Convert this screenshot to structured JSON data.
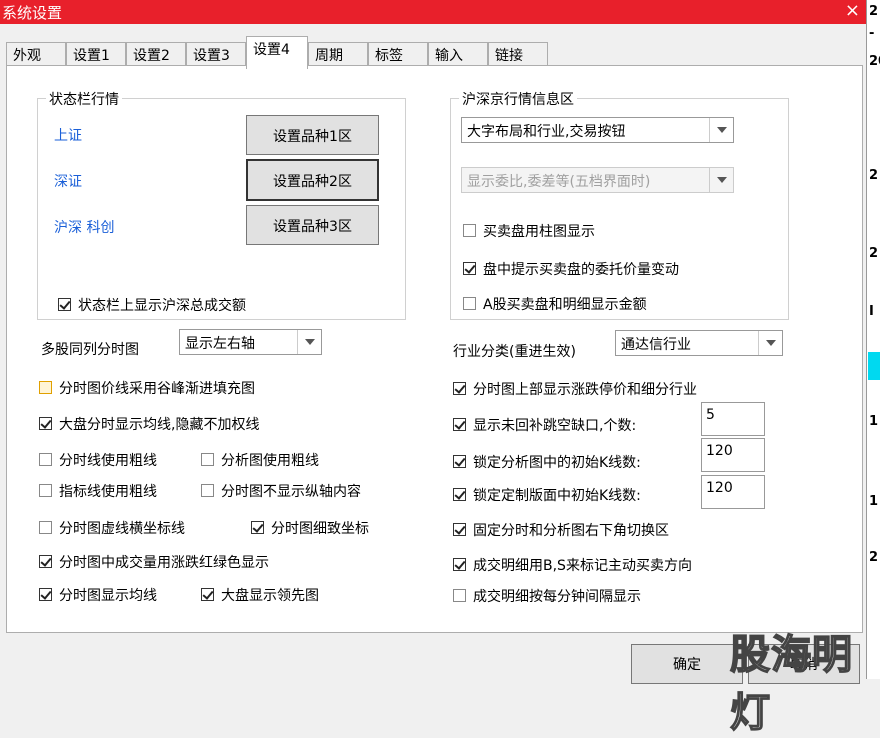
{
  "window": {
    "title": "系统设置",
    "close": "×"
  },
  "tabs": [
    "外观",
    "设置1",
    "设置2",
    "设置3",
    "设置4",
    "周期",
    "标签",
    "输入",
    "链接"
  ],
  "status_group": {
    "title": "状态栏行情",
    "rows": [
      {
        "label": "上证",
        "button": "设置品种1区"
      },
      {
        "label": "深证",
        "button": "设置品种2区"
      },
      {
        "label": "沪深 科创",
        "button": "设置品种3区"
      }
    ],
    "checkbox": {
      "label": "状态栏上显示沪深总成交额",
      "checked": true
    }
  },
  "info_group": {
    "title": "沪深京行情信息区",
    "layout_select": "大字布局和行业,交易按钮",
    "disabled_select": "显示委比,委差等(五档界面时)",
    "checks": [
      {
        "label": "买卖盘用柱图显示",
        "checked": false
      },
      {
        "label": "盘中提示买卖盘的委托价量变动",
        "checked": true
      },
      {
        "label": "A股买卖盘和明细显示金额",
        "checked": false
      }
    ]
  },
  "multi": {
    "label": "多股同列分时图",
    "value": "显示左右轴"
  },
  "industry": {
    "label": "行业分类(重进生效)",
    "value": "通达信行业"
  },
  "left_checks": {
    "gradient": {
      "label": "分时图价线采用谷峰渐进填充图",
      "checked": false
    },
    "avg": {
      "label": "大盘分时显示均线,隐藏不加权线",
      "checked": true
    },
    "thick1": {
      "label": "分时线使用粗线",
      "checked": false
    },
    "thick2": {
      "label": "分析图使用粗线",
      "checked": false
    },
    "thick3": {
      "label": "指标线使用粗线",
      "checked": false
    },
    "noaxis": {
      "label": "分时图不显示纵轴内容",
      "checked": false
    },
    "dashed": {
      "label": "分时图虚线横坐标线",
      "checked": false
    },
    "fine": {
      "label": "分时图细致坐标",
      "checked": true
    },
    "redgreen": {
      "label": "分时图中成交量用涨跌红绿色显示",
      "checked": true
    },
    "showavg": {
      "label": "分时图显示均线",
      "checked": true
    },
    "lead": {
      "label": "大盘显示领先图",
      "checked": true
    }
  },
  "right_checks": {
    "limit": {
      "label": "分时图上部显示涨跌停价和细分行业",
      "checked": true
    },
    "gap": {
      "label": "显示未回补跳空缺口,个数:",
      "checked": true,
      "value": "5"
    },
    "lockk": {
      "label": "锁定分析图中的初始K线数:",
      "checked": true,
      "value": "120"
    },
    "lockcustom": {
      "label": "锁定定制版面中初始K线数:",
      "checked": true,
      "value": "120"
    },
    "fixed": {
      "label": "固定分时和分析图右下角切换区",
      "checked": true
    },
    "bs": {
      "label": "成交明细用B,S来标记主动买卖方向",
      "checked": true
    },
    "minute": {
      "label": "成交明细按每分钟间隔显示",
      "checked": false
    }
  },
  "buttons": {
    "ok": "确定",
    "cancel": "取消"
  },
  "watermark": "股海明灯",
  "right_strip": [
    "2",
    "-",
    "20",
    "2",
    "2",
    "I",
    "1",
    "1",
    "2"
  ]
}
